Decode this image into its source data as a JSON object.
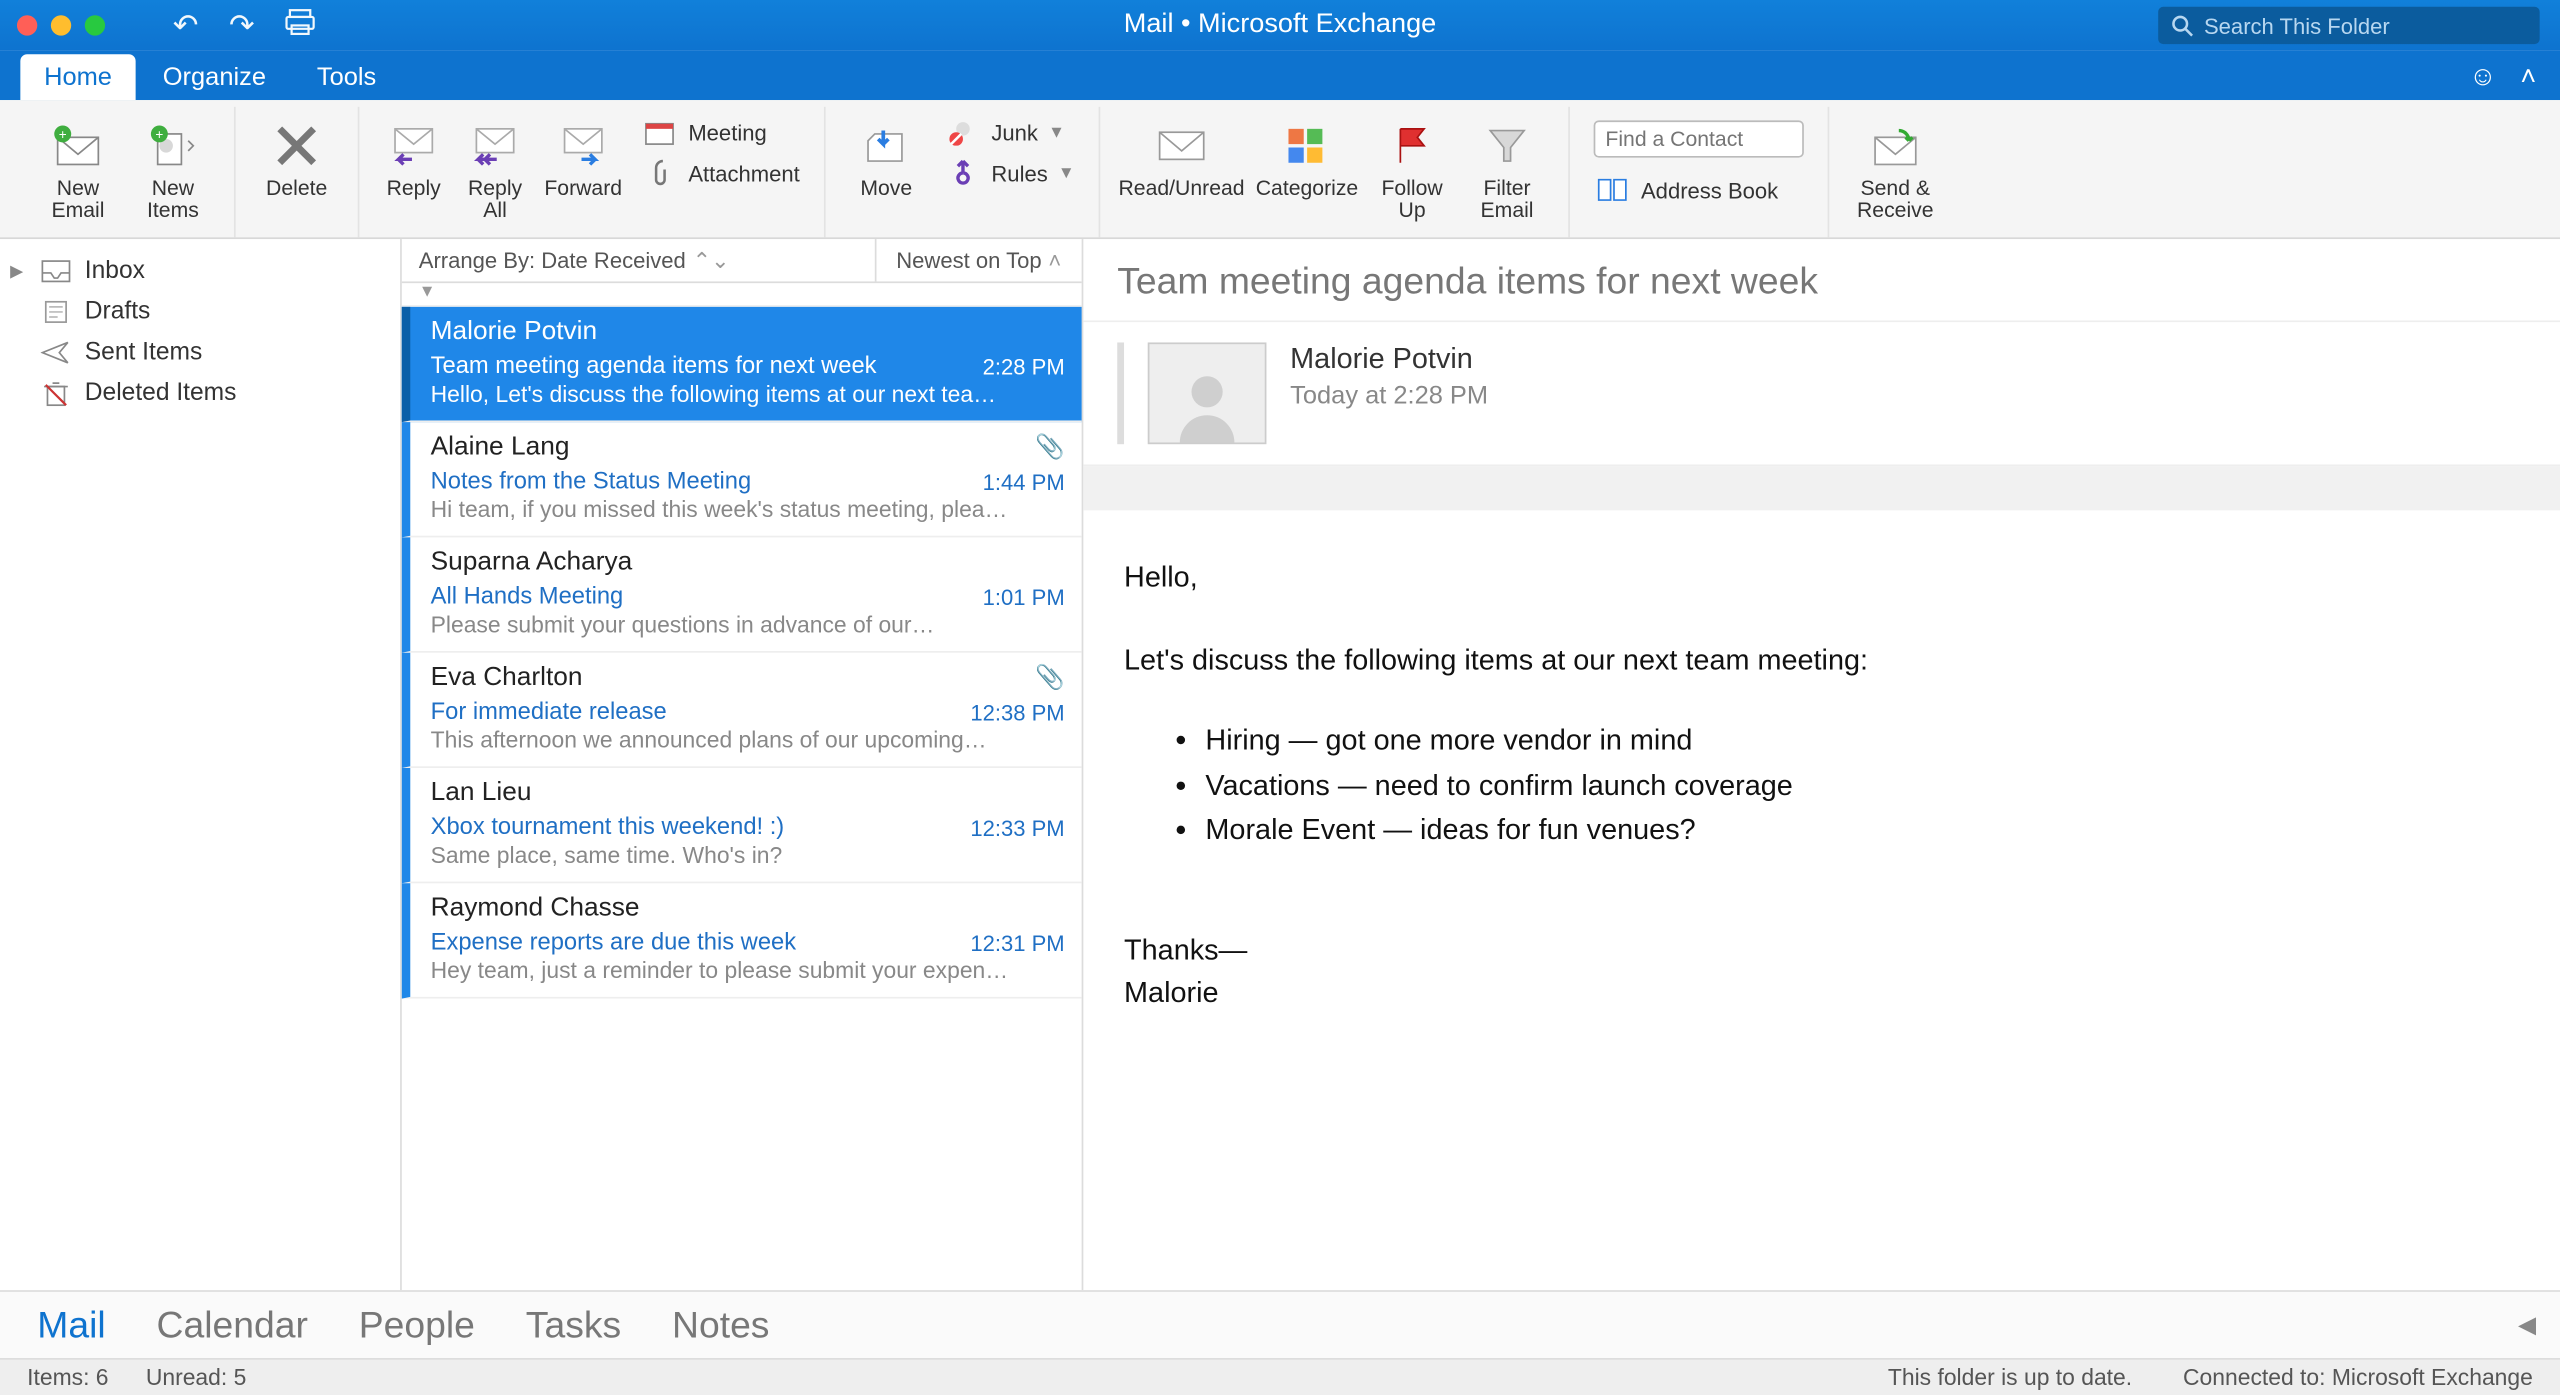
{
  "window": {
    "title": "Mail • Microsoft Exchange",
    "search_placeholder": "Search This Folder"
  },
  "tabs": {
    "items": [
      "Home",
      "Organize",
      "Tools"
    ],
    "active": 0
  },
  "ribbon": {
    "new_email": "New\nEmail",
    "new_items": "New\nItems",
    "delete": "Delete",
    "reply": "Reply",
    "reply_all": "Reply\nAll",
    "forward": "Forward",
    "meeting": "Meeting",
    "attachment": "Attachment",
    "move": "Move",
    "junk": "Junk",
    "rules": "Rules",
    "read_unread": "Read/Unread",
    "categorize": "Categorize",
    "follow_up": "Follow\nUp",
    "filter_email": "Filter\nEmail",
    "find_contact_placeholder": "Find a Contact",
    "address_book": "Address Book",
    "send_receive": "Send &\nReceive"
  },
  "folders": [
    {
      "name": "Inbox",
      "icon": "inbox"
    },
    {
      "name": "Drafts",
      "icon": "drafts"
    },
    {
      "name": "Sent Items",
      "icon": "sent"
    },
    {
      "name": "Deleted Items",
      "icon": "deleted"
    }
  ],
  "arrange": {
    "by": "Arrange By: Date Received",
    "sort": "Newest on Top"
  },
  "messages": [
    {
      "from": "Malorie Potvin",
      "subject": "Team meeting agenda items for next week",
      "preview": "Hello, Let's discuss the following items at our next tea…",
      "time": "2:28 PM",
      "selected": true,
      "unread": true,
      "attachment": false
    },
    {
      "from": "Alaine Lang",
      "subject": "Notes from the Status Meeting",
      "preview": "Hi team, if you missed this week's status meeting, plea…",
      "time": "1:44 PM",
      "unread": true,
      "attachment": true
    },
    {
      "from": "Suparna Acharya",
      "subject": "All Hands Meeting",
      "preview": "Please submit your questions in advance of our…",
      "time": "1:01 PM",
      "unread": true
    },
    {
      "from": "Eva Charlton",
      "subject": "For immediate release",
      "preview": "This afternoon we announced plans of our upcoming…",
      "time": "12:38 PM",
      "unread": true,
      "attachment": true
    },
    {
      "from": "Lan Lieu",
      "subject": "Xbox tournament this weekend!  :)",
      "preview": "Same place, same time. Who's in?",
      "time": "12:33 PM",
      "unread": true
    },
    {
      "from": "Raymond Chasse",
      "subject": "Expense reports are due this week",
      "preview": "Hey team, just a reminder to please submit your expen…",
      "time": "12:31 PM",
      "unread": true
    }
  ],
  "reader": {
    "subject": "Team meeting agenda items for next week",
    "from": "Malorie Potvin",
    "date": "Today at 2:28 PM",
    "body": {
      "greeting": "Hello,",
      "lead": "Let's discuss the following items at our next team meeting:",
      "bullets": [
        "Hiring — got one more vendor in mind",
        "Vacations — need to confirm launch coverage",
        "Morale Event — ideas for fun venues?"
      ],
      "signoff": "Thanks—",
      "name": "Malorie"
    }
  },
  "nav": [
    "Mail",
    "Calendar",
    "People",
    "Tasks",
    "Notes"
  ],
  "nav_active": 0,
  "status": {
    "items": "Items: 6",
    "unread": "Unread: 5",
    "uptodate": "This folder is up to date.",
    "connected": "Connected to: Microsoft Exchange"
  }
}
